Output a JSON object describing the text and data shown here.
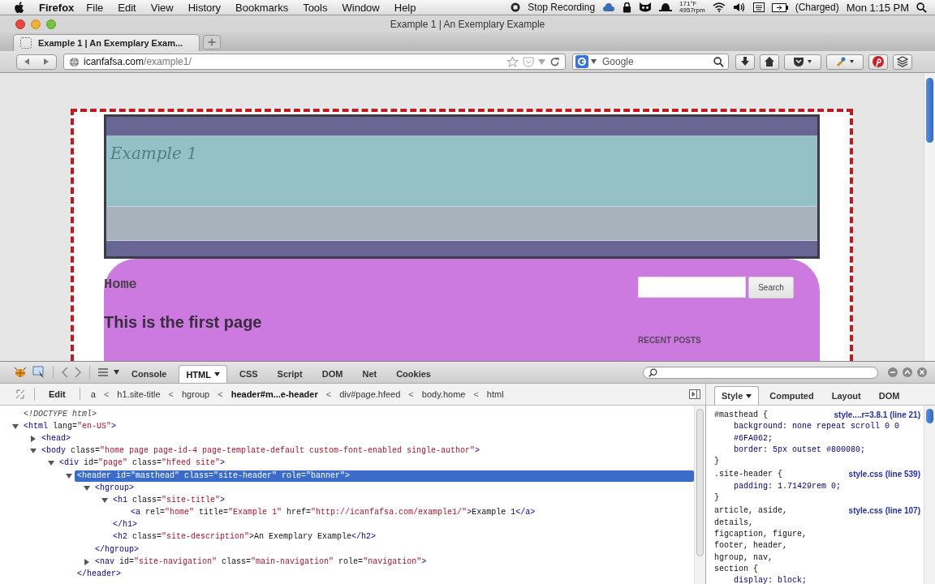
{
  "menubar": {
    "app": "Firefox",
    "menus": [
      "File",
      "Edit",
      "View",
      "History",
      "Bookmarks",
      "Tools",
      "Window",
      "Help"
    ],
    "recording": "Stop Recording",
    "temperature": "171°F",
    "fan_speed": "4957rpm",
    "battery": "(Charged)",
    "clock": "Mon 1:15 PM"
  },
  "window": {
    "title": "Example 1 | An Exemplary Example"
  },
  "tabs": [
    {
      "label": "Example 1 | An Exemplary Exam...",
      "selected": true
    }
  ],
  "navbar": {
    "url_host": "icanfafsa.com",
    "url_path": "/example1/",
    "search_placeholder": "Google"
  },
  "page": {
    "site_title": "Example 1",
    "page_title": "Home",
    "search_button": "Search",
    "heading": "This is the first page",
    "widget_title": "RECENT POSTS"
  },
  "firebug": {
    "panel_tabs": [
      {
        "label": "Console",
        "selected": false
      },
      {
        "label": "HTML",
        "selected": true
      },
      {
        "label": "CSS",
        "selected": false
      },
      {
        "label": "Script",
        "selected": false
      },
      {
        "label": "DOM",
        "selected": false
      },
      {
        "label": "Net",
        "selected": false
      },
      {
        "label": "Cookies",
        "selected": false
      }
    ],
    "edit_button": "Edit",
    "breadcrumbs": [
      {
        "label": "a",
        "selected": false,
        "separator": "<"
      },
      {
        "label": "h1.site-title",
        "selected": false,
        "separator": "<"
      },
      {
        "label": "hgroup",
        "selected": false,
        "separator": "<"
      },
      {
        "label": "header#m...e-header",
        "selected": true,
        "separator": "<"
      },
      {
        "label": "div#page.hfeed",
        "selected": false,
        "separator": "<"
      },
      {
        "label": "body.home",
        "selected": false,
        "separator": "<"
      },
      {
        "label": "html",
        "selected": false
      }
    ],
    "side_tabs": [
      {
        "label": "Style",
        "selected": true
      },
      {
        "label": "Computed",
        "selected": false
      },
      {
        "label": "Layout",
        "selected": false
      },
      {
        "label": "DOM",
        "selected": false
      }
    ],
    "tree": [
      {
        "segments": [
          {
            "kind": "comment",
            "text": "<!DOCTYPE html>"
          }
        ]
      },
      {
        "expanded": true,
        "selected": false,
        "segments": [
          {
            "kind": "tag",
            "text": "<html"
          },
          {
            "kind": "attr",
            "text": " lang="
          },
          {
            "kind": "value",
            "text": "\"en-US\""
          },
          {
            "kind": "tag",
            "text": ">"
          }
        ],
        "children": [
          {
            "expanded": false,
            "selected": false,
            "segments": [
              {
                "kind": "tag",
                "text": "<head>"
              }
            ]
          },
          {
            "expanded": true,
            "selected": false,
            "segments": [
              {
                "kind": "tag",
                "text": "<body"
              },
              {
                "kind": "attr",
                "text": " class="
              },
              {
                "kind": "value",
                "text": "\"home page page-id-4 page-template-default custom-font-enabled single-author\""
              },
              {
                "kind": "tag",
                "text": ">"
              }
            ],
            "children": [
              {
                "expanded": true,
                "selected": false,
                "segments": [
                  {
                    "kind": "tag",
                    "text": "<div"
                  },
                  {
                    "kind": "attr",
                    "text": " id="
                  },
                  {
                    "kind": "value",
                    "text": "\"page\""
                  },
                  {
                    "kind": "attr",
                    "text": " class="
                  },
                  {
                    "kind": "value",
                    "text": "\"hfeed site\""
                  },
                  {
                    "kind": "tag",
                    "text": ">"
                  }
                ],
                "children": [
                  {
                    "expanded": true,
                    "selected": true,
                    "line": "<header id=\"masthead\" class=\"site-header\" role=\"banner\">",
                    "end": "</header>",
                    "children": [
                      {
                        "expanded": true,
                        "selected": false,
                        "segments": [
                          {
                            "kind": "tag",
                            "text": "<hgroup>"
                          }
                        ],
                        "end": "</hgroup>",
                        "children": [
                          {
                            "expanded": true,
                            "selected": false,
                            "segments": [
                              {
                                "kind": "tag",
                                "text": "<h1"
                              },
                              {
                                "kind": "attr",
                                "text": " class="
                              },
                              {
                                "kind": "value",
                                "text": "\"site-title\""
                              },
                              {
                                "kind": "tag",
                                "text": ">"
                              }
                            ],
                            "end": "</h1>",
                            "children": [
                              {
                                "segments": [
                                  {
                                    "kind": "tag",
                                    "text": "<a"
                                  },
                                  {
                                    "kind": "attr",
                                    "text": " rel="
                                  },
                                  {
                                    "kind": "value",
                                    "text": "\"home\""
                                  },
                                  {
                                    "kind": "attr",
                                    "text": " title="
                                  },
                                  {
                                    "kind": "value",
                                    "text": "\"Example 1\""
                                  },
                                  {
                                    "kind": "attr",
                                    "text": " href="
                                  },
                                  {
                                    "kind": "value",
                                    "text": "\"http://icanfafsa.com/example1/\""
                                  },
                                  {
                                    "kind": "tag",
                                    "text": ">"
                                  },
                                  {
                                    "kind": "text",
                                    "text": "Example 1"
                                  },
                                  {
                                    "kind": "tag",
                                    "text": "</a>"
                                  }
                                ]
                              }
                            ]
                          },
                          {
                            "segments": [
                              {
                                "kind": "tag",
                                "text": "<h2"
                              },
                              {
                                "kind": "attr",
                                "text": " class="
                              },
                              {
                                "kind": "value",
                                "text": "\"site-description\""
                              },
                              {
                                "kind": "tag",
                                "text": ">"
                              },
                              {
                                "kind": "text",
                                "text": "An Exemplary Example"
                              },
                              {
                                "kind": "tag",
                                "text": "</h2>"
                              }
                            ]
                          }
                        ]
                      },
                      {
                        "expanded": false,
                        "selected": false,
                        "segments": [
                          {
                            "kind": "tag",
                            "text": "<nav"
                          },
                          {
                            "kind": "attr",
                            "text": " id="
                          },
                          {
                            "kind": "value",
                            "text": "\"site-navigation\""
                          },
                          {
                            "kind": "attr",
                            "text": " class="
                          },
                          {
                            "kind": "value",
                            "text": "\"main-navigation\""
                          },
                          {
                            "kind": "attr",
                            "text": " role="
                          },
                          {
                            "kind": "value",
                            "text": "\"navigation\""
                          },
                          {
                            "kind": "tag",
                            "text": ">"
                          }
                        ]
                      }
                    ]
                  }
                ]
              }
            ]
          }
        ]
      }
    ],
    "style_rules": [
      {
        "selector": [
          "#masthead {"
        ],
        "source": "style....r=3.8.1 (line 21)",
        "declarations": [
          "background: none repeat scroll 0 0 #6FA062;",
          "border: 5px outset #800080;"
        ],
        "close": "}"
      },
      {
        "selector": [
          ".site-header {"
        ],
        "source": "style.css (line 539)",
        "declarations": [
          "padding: 1.71429rem 0;"
        ],
        "close": "}"
      },
      {
        "selector": [
          "article, aside,",
          "details,",
          "figcaption, figure,",
          "footer, header,",
          "hgroup, nav,",
          "section {"
        ],
        "source": "style.css (line 107)",
        "declarations": [
          "display: block;"
        ]
      }
    ]
  }
}
